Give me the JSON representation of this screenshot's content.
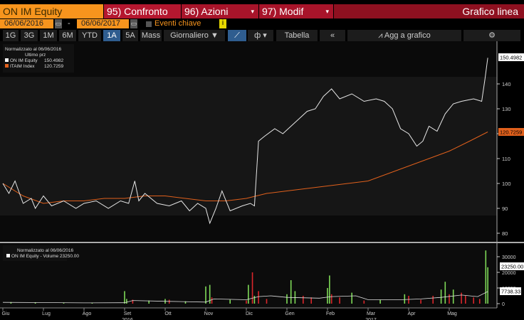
{
  "header": {
    "security": "ON IM Equity",
    "compare": "95) Confronto",
    "actions": "96) Azioni",
    "modify": "97) Modif",
    "chart_type": "Grafico linea"
  },
  "dates": {
    "start": "06/06/2016",
    "sep": "-",
    "end": "06/06/2017",
    "key_events": "Eventi chiave",
    "info": "i"
  },
  "toolbar": {
    "periods": [
      "1G",
      "3G",
      "1M",
      "6M",
      "YTD",
      "1A",
      "5A",
      "Mass"
    ],
    "active_period": "1A",
    "frequency": "Giornaliero ▼",
    "table": "Tabella",
    "collapse": "«",
    "add_to_chart": "Agg a grafico",
    "settings": "⚙"
  },
  "colors": {
    "equity": "#e6e6e6",
    "index": "#e0601c",
    "up": "#7ed957",
    "down": "#d9262b",
    "accent": "#f7941d",
    "brand_red": "#a8142a"
  },
  "chart_data": [
    {
      "type": "line",
      "title": "Normalizzato al 06/06/2016",
      "subtitle": "Ultimo prz",
      "x_unit": "months since 06/06/2016",
      "x_ticks": [
        "Giu",
        "Lug",
        "Ago",
        "Set",
        "Ott",
        "Nov",
        "Dic",
        "Gen",
        "Feb",
        "Mar",
        "Apr",
        "Mag"
      ],
      "year_labels": [
        {
          "label": "2016",
          "month": 3
        },
        {
          "label": "2017",
          "month": 9
        }
      ],
      "yticks": [
        80,
        90,
        100,
        110,
        120,
        130,
        140
      ],
      "ylim": [
        77,
        155
      ],
      "series": [
        {
          "name": "ON IM Equity",
          "last": "150.4982",
          "x": [
            0,
            0.15,
            0.3,
            0.5,
            0.7,
            0.8,
            1.0,
            1.2,
            1.5,
            1.8,
            2.0,
            2.3,
            2.6,
            2.9,
            3.1,
            3.25,
            3.35,
            3.5,
            3.8,
            4.1,
            4.4,
            4.6,
            4.8,
            5.0,
            5.1,
            5.25,
            5.4,
            5.6,
            5.9,
            6.1,
            6.2,
            6.3,
            6.45,
            6.7,
            6.9,
            7.1,
            7.3,
            7.5,
            7.7,
            7.9,
            8.1,
            8.3,
            8.6,
            8.9,
            9.2,
            9.4,
            9.6,
            9.8,
            10.0,
            10.2,
            10.35,
            10.5,
            10.7,
            10.9,
            11.1,
            11.3,
            11.6,
            11.8,
            11.88,
            11.95
          ],
          "values": [
            100,
            96,
            101,
            92,
            94,
            90,
            95,
            91,
            93,
            90,
            92,
            93,
            90,
            93,
            92,
            101,
            93,
            96,
            92,
            91,
            93,
            89,
            92,
            90,
            84,
            90,
            97,
            89,
            91,
            92,
            91,
            117,
            119,
            122,
            120,
            123,
            126,
            129,
            130,
            135,
            138,
            134,
            136,
            133,
            134,
            133,
            130,
            122,
            120,
            115,
            117,
            123,
            121,
            128,
            132,
            133,
            134,
            133,
            142,
            150.5
          ]
        },
        {
          "name": "ITAIM Index",
          "last": "120.7259",
          "x": [
            0,
            0.5,
            1,
            1.5,
            2,
            2.5,
            3,
            3.5,
            4,
            4.5,
            5,
            5.5,
            6,
            6.5,
            7,
            7.5,
            8,
            8.5,
            9,
            9.5,
            10,
            10.5,
            11,
            11.5,
            11.95
          ],
          "values": [
            100,
            95,
            92,
            93,
            93,
            94,
            94,
            95,
            95,
            94,
            93,
            93,
            94,
            96,
            97,
            98,
            99,
            100,
            101,
            104,
            107,
            110,
            113,
            117,
            120.7
          ]
        }
      ]
    },
    {
      "type": "bar",
      "title": "Normalizzato al 06/06/2016",
      "legend": "ON IM Equity - Volume 23250.00",
      "last": "23250.00",
      "avg_last": "7738.33",
      "yticks": [
        0,
        10000,
        20000,
        30000
      ],
      "ylim": [
        -2000,
        36000
      ],
      "x": [
        0.2,
        0.8,
        1.5,
        2.2,
        3.0,
        3.05,
        3.2,
        3.6,
        4.0,
        4.1,
        4.5,
        5.0,
        5.1,
        5.15,
        5.6,
        6.0,
        6.05,
        6.15,
        6.2,
        6.3,
        6.5,
        7.0,
        7.1,
        7.2,
        7.4,
        7.6,
        8.0,
        8.05,
        8.1,
        8.3,
        8.6,
        8.9,
        9.3,
        9.9,
        10.0,
        10.3,
        10.6,
        10.8,
        10.9,
        11.0,
        11.1,
        11.3,
        11.4,
        11.6,
        11.75,
        11.9,
        11.95
      ],
      "values": [
        1000,
        800,
        600,
        500,
        8000,
        3000,
        2500,
        2000,
        3000,
        2500,
        1500,
        11000,
        12000,
        4000,
        2500,
        2000,
        12000,
        20000,
        5000,
        8000,
        3000,
        6000,
        15000,
        8000,
        5000,
        4000,
        10000,
        18000,
        6000,
        4000,
        7000,
        2000,
        2500,
        6000,
        5000,
        2500,
        5000,
        9000,
        14000,
        6000,
        9000,
        7000,
        5000,
        4000,
        3000,
        34000,
        23250
      ],
      "up": [
        true,
        true,
        true,
        true,
        true,
        true,
        false,
        true,
        true,
        false,
        true,
        true,
        true,
        false,
        true,
        false,
        true,
        false,
        true,
        false,
        false,
        true,
        true,
        true,
        false,
        false,
        true,
        true,
        false,
        false,
        true,
        false,
        true,
        true,
        false,
        false,
        false,
        true,
        true,
        false,
        true,
        false,
        false,
        false,
        false,
        true,
        true
      ],
      "avg_x": [
        0,
        1,
        2,
        3,
        3.2,
        4,
        5,
        5.2,
        6,
        6.3,
        6.6,
        7,
        7.8,
        8.1,
        8.7,
        9,
        9.8,
        10.3,
        10.8,
        11.3,
        11.7,
        11.95
      ],
      "avg_values": [
        800,
        700,
        500,
        600,
        2000,
        1500,
        1000,
        3000,
        2500,
        4500,
        5000,
        4000,
        3500,
        4500,
        5000,
        2500,
        2500,
        3000,
        4000,
        5500,
        4500,
        7738
      ]
    }
  ]
}
